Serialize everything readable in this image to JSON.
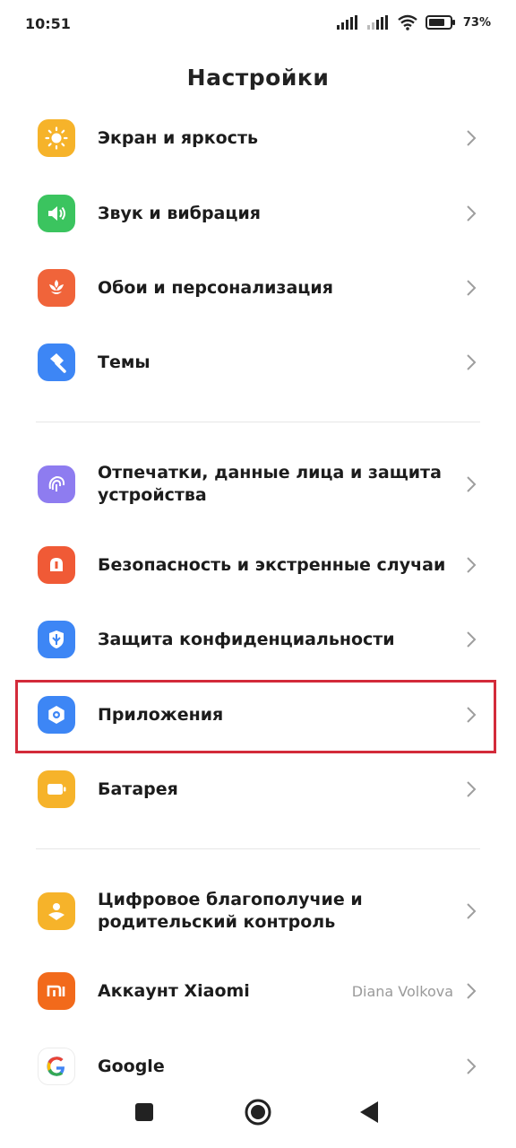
{
  "status_bar": {
    "time": "10:51",
    "battery_percent": "73%"
  },
  "header": {
    "title": "Настройки"
  },
  "settings": {
    "items": [
      {
        "label": "Экран и яркость",
        "icon": "sun-icon",
        "color": "#F6B32A"
      },
      {
        "label": "Звук и вибрация",
        "icon": "speaker-icon",
        "color": "#3BC45F"
      },
      {
        "label": "Обои и персонализация",
        "icon": "flower-icon",
        "color": "#F0643A"
      },
      {
        "label": "Темы",
        "icon": "brush-icon",
        "color": "#3D86F5"
      },
      {
        "label": "Отпечатки, данные лица и защита устройства",
        "icon": "fingerprint-icon",
        "color": "#8E7CF0"
      },
      {
        "label": "Безопасность и экстренные случаи",
        "icon": "emergency-icon",
        "color": "#F05A36"
      },
      {
        "label": "Защита конфиденциальности",
        "icon": "privacy-shield-icon",
        "color": "#3D86F5"
      },
      {
        "label": "Приложения",
        "icon": "apps-gear-icon",
        "color": "#3D86F5"
      },
      {
        "label": "Батарея",
        "icon": "battery-icon",
        "color": "#F6B32A"
      },
      {
        "label": "Цифровое благополучие и родительский контроль",
        "icon": "wellbeing-icon",
        "color": "#F6B32A"
      },
      {
        "label": "Аккаунт Xiaomi",
        "value": "Diana Volkova",
        "icon": "xiaomi-icon",
        "color": "#F26A1B"
      },
      {
        "label": "Google",
        "icon": "google-icon",
        "color": "#FFFFFF"
      }
    ]
  },
  "nav_bar": {
    "buttons": [
      "recents",
      "home",
      "back"
    ]
  },
  "highlight_color": "#D32B3A"
}
